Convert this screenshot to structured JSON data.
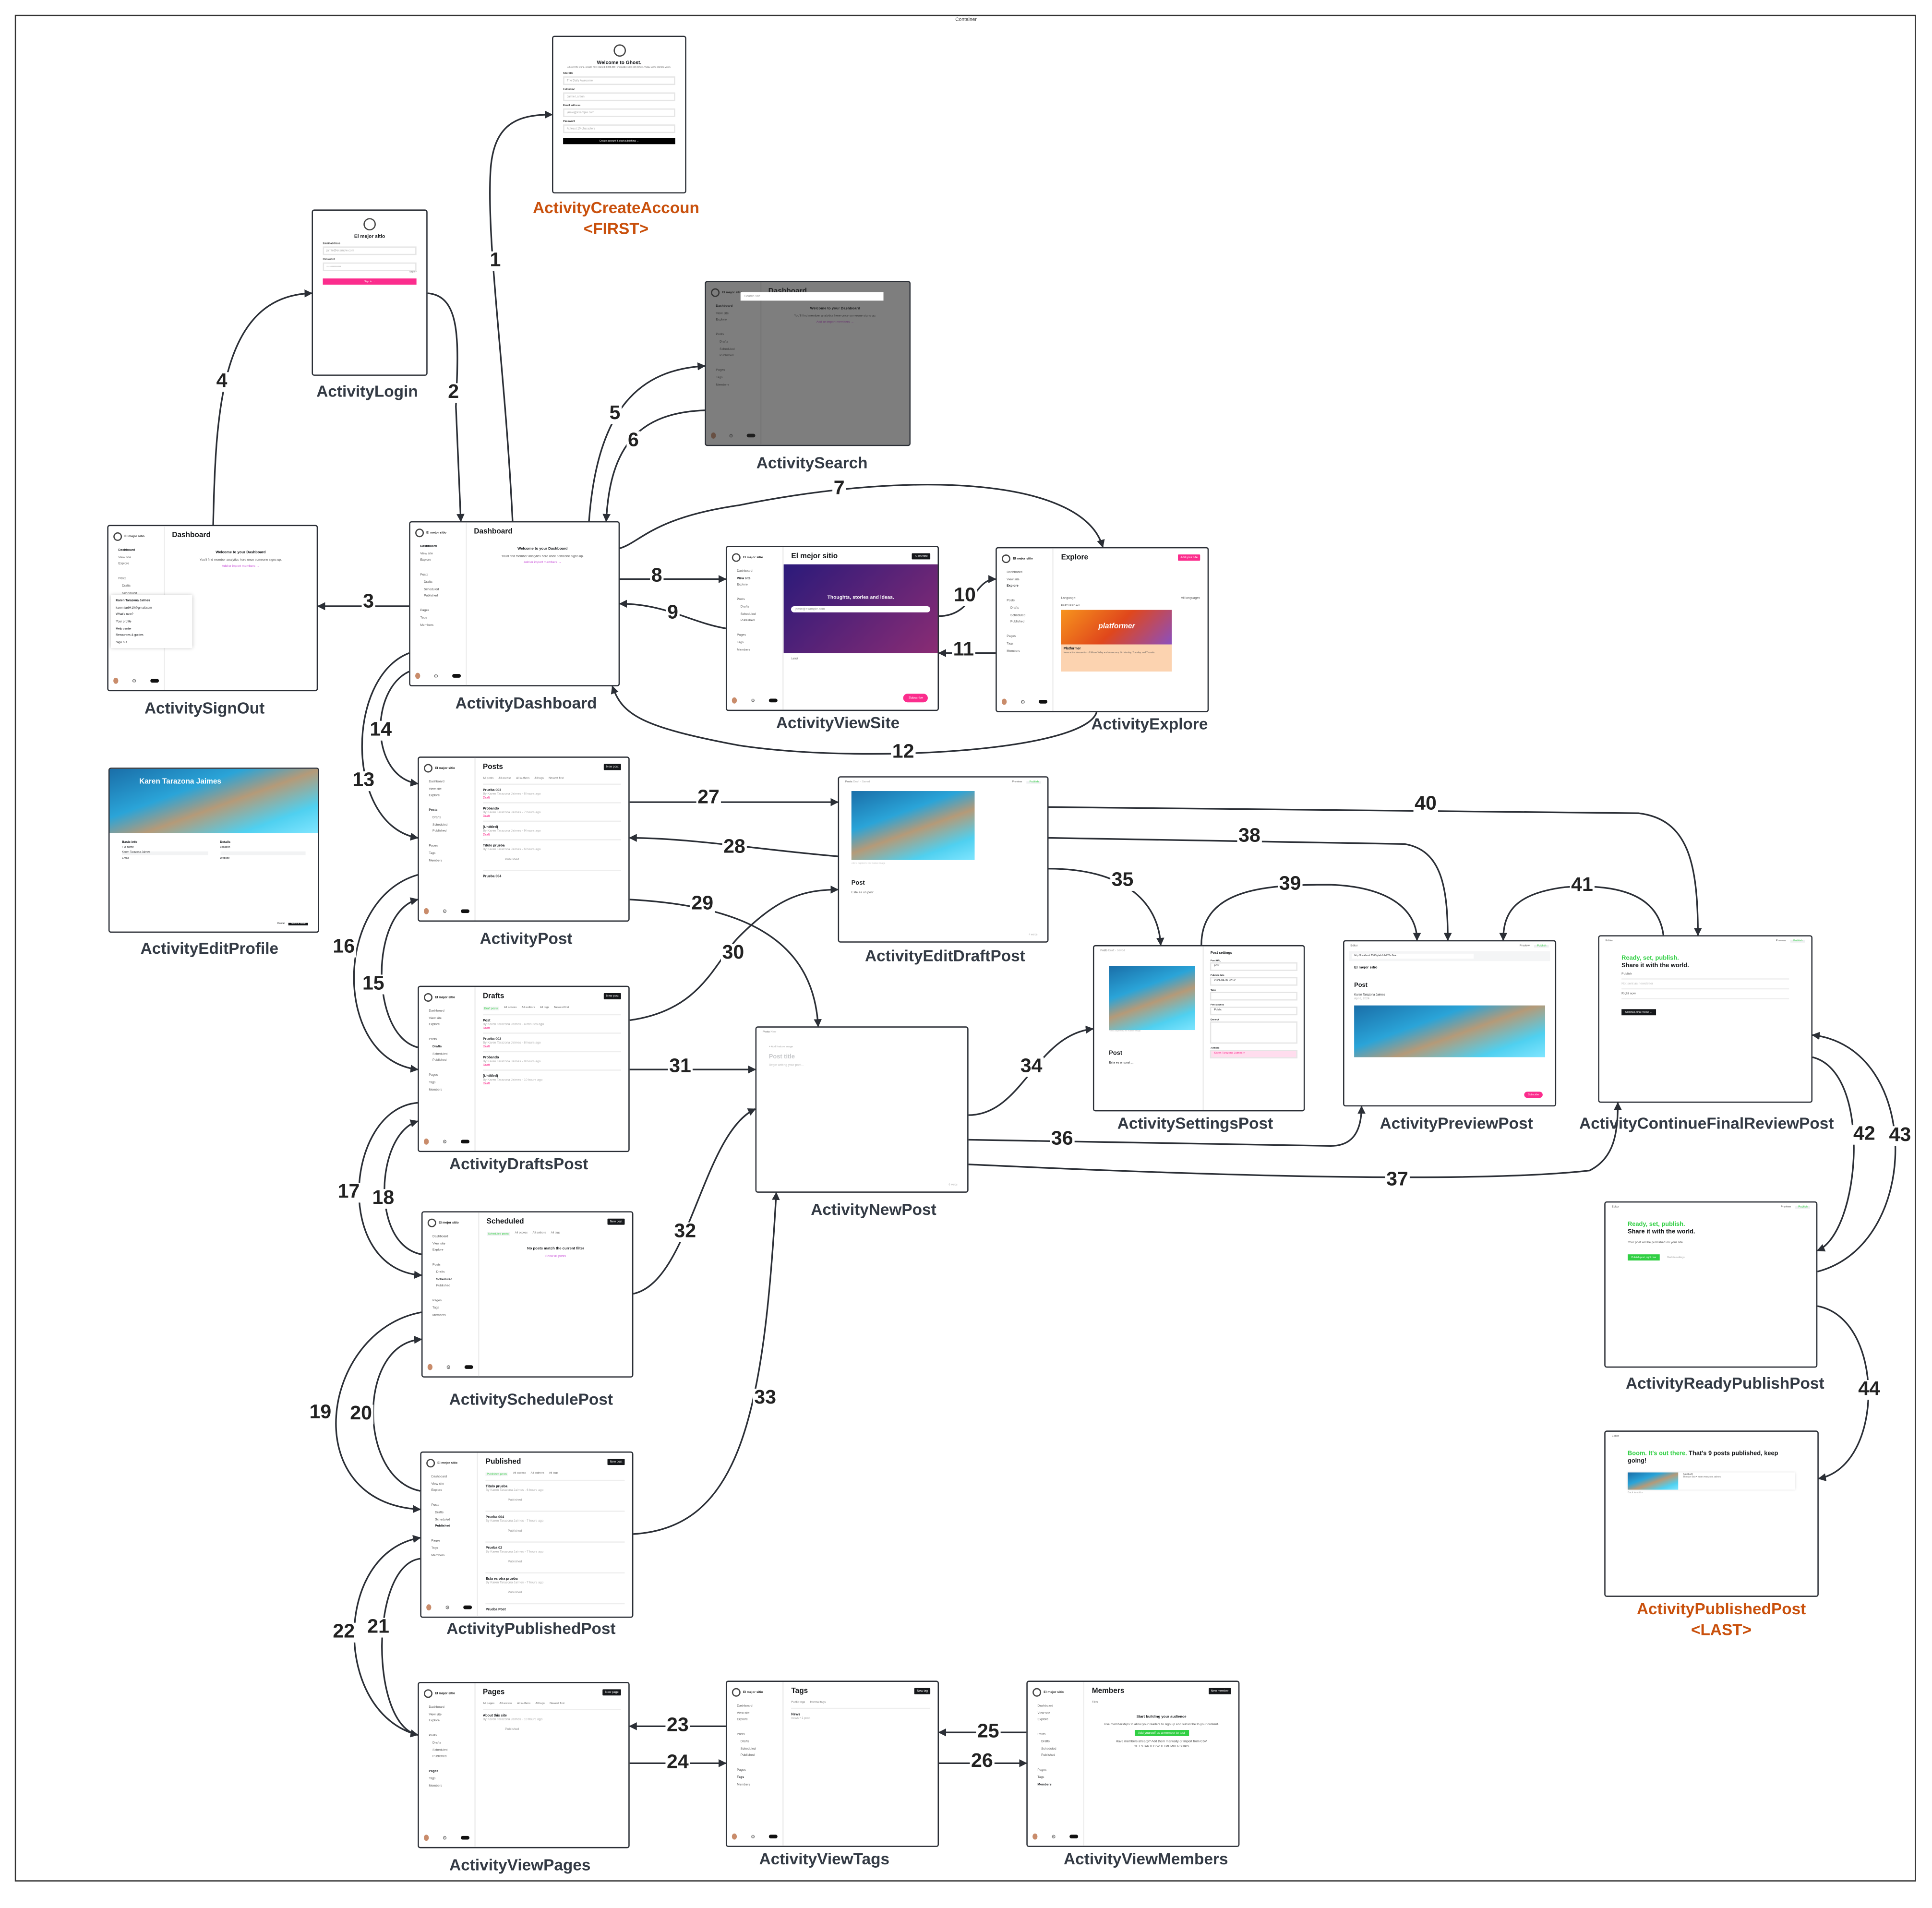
{
  "container_label": "Container",
  "sidebar": {
    "site": "El mejor sitio",
    "items": [
      "Dashboard",
      "View site",
      "Explore",
      "Posts",
      "Drafts",
      "Scheduled",
      "Published",
      "Pages",
      "Tags",
      "Members"
    ],
    "members_count": "0"
  },
  "colors": {
    "accent_green": "#30cf43",
    "accent_pink": "#fb2d8d",
    "label_default": "#333a44",
    "label_terminal": "#c9500c",
    "edge": "#2b2f36"
  },
  "nodes": [
    {
      "id": "create",
      "label": "ActivityCreateAccoun",
      "tag": "<FIRST>",
      "type": "form",
      "screen": {
        "title": "Welcome to Ghost.",
        "subtitle": "All over the world, people have started 3,000,000+ incredible sites with Ghost. Today, we're starting yours.",
        "fields": [
          {
            "label": "Site title",
            "placeholder": "The Daily Awesome"
          },
          {
            "label": "Full name",
            "placeholder": "Jamie Larson"
          },
          {
            "label": "Email address",
            "placeholder": "jamie@example.com"
          },
          {
            "label": "Password",
            "placeholder": "At least 10 characters"
          }
        ],
        "button": "Create account & start publishing →"
      }
    },
    {
      "id": "login",
      "label": "ActivityLogin",
      "type": "form",
      "screen": {
        "title": "El mejor sitio",
        "fields": [
          {
            "label": "Email address",
            "placeholder": "jamie@example.com"
          },
          {
            "label": "Password",
            "placeholder": "••••••••••••••"
          }
        ],
        "link": "Forgot?",
        "button": "Sign in →"
      }
    },
    {
      "id": "search",
      "label": "ActivitySearch",
      "type": "admin",
      "dim": true,
      "screen": {
        "title": "Dashboard",
        "search_placeholder": "Search site",
        "body": [
          "Welcome to your Dashboard",
          "You'll find member analytics here once someone signs up.",
          "Add or import members →"
        ]
      }
    },
    {
      "id": "signout",
      "label": "ActivitySignOut",
      "type": "admin",
      "screen": {
        "title": "Dashboard",
        "menu": [
          "Karen Tarazona Jaimes",
          "karen.far9410@gmail.com",
          "What's new?",
          "Your profile",
          "Help center",
          "Resources & guides",
          "Sign out"
        ],
        "body": [
          "Welcome to your Dashboard",
          "You'll find member analytics here once someone signs up.",
          "Add or import members →"
        ]
      }
    },
    {
      "id": "dashboard",
      "label": "ActivityDashboard",
      "type": "admin",
      "screen": {
        "title": "Dashboard",
        "body": [
          "Welcome to your Dashboard",
          "You'll find member analytics here once someone signs up.",
          "Add or import members →"
        ]
      }
    },
    {
      "id": "viewsite",
      "label": "ActivityViewSite",
      "type": "admin",
      "screen": {
        "title": "El mejor sitio",
        "hero": "Thoughts, stories and ideas.",
        "email_placeholder": "jamie@example.com",
        "latest": "Latest",
        "button": "Subscribe"
      }
    },
    {
      "id": "explore",
      "label": "ActivityExplore",
      "type": "admin",
      "screen": {
        "title": "Explore",
        "button": "Add your site",
        "language_label": "Language:",
        "language_value": "All languages",
        "featured": "FEATURED  ALL",
        "card_logo": "platformer",
        "card_title": "Platformer",
        "card_text": "News at the intersection of Silicon Valley and democracy. On Monday, Tuesday, and Thursda..."
      }
    },
    {
      "id": "editprofile",
      "label": "ActivityEditProfile",
      "type": "profile",
      "screen": {
        "name": "Karen Tarazona Jaimes",
        "basic": "Basic info",
        "details": "Details",
        "full_name_label": "Full name",
        "full_name": "Karen Tarazona Jaimes",
        "location_label": "Location",
        "email_label": "Email",
        "website_label": "Website",
        "cancel": "Cancel",
        "save": "Save & close"
      }
    },
    {
      "id": "post",
      "label": "ActivityPost",
      "type": "admin",
      "screen": {
        "title": "Posts",
        "button": "New post",
        "filters": [
          "All posts",
          "All access",
          "All authors",
          "All tags",
          "Newest first"
        ],
        "items": [
          {
            "title": "Prueba 003",
            "meta": "By Karen Tarazona Jaimes - 6 hours ago",
            "status": "Draft"
          },
          {
            "title": "Probando",
            "meta": "By Karen Tarazona Jaimes - 7 hours ago",
            "status": "Draft"
          },
          {
            "title": "(Untitled)",
            "meta": "By Karen Tarazona Jaimes - 9 hours ago",
            "status": "Draft"
          },
          {
            "title": "Titulo prueba",
            "meta": "By Karen Tarazona Jaimes - 6 hours ago",
            "status": "Published"
          },
          {
            "title": "Prueba 004",
            "meta": "",
            "status": ""
          }
        ]
      }
    },
    {
      "id": "editdraft",
      "label": "ActivityEditDraftPost",
      "type": "editor",
      "screen": {
        "back": "Posts",
        "state": "Draft - Saved",
        "preview": "Preview",
        "publish": "Publish",
        "caption": "Add a caption to the feature image",
        "title": "Post",
        "body": "Este es un post ...",
        "words": "4 words"
      }
    },
    {
      "id": "settings",
      "label": "ActivitySettingsPost",
      "type": "settings",
      "screen": {
        "back": "Posts",
        "state": "Draft - Saved",
        "caption": "Add a caption to the feature image",
        "title": "Post",
        "body": "Este es un post ...",
        "panel_title": "Post settings",
        "fields": [
          {
            "label": "Post URL",
            "value": "post"
          },
          {
            "label": "Publish date",
            "value": "2024-04-06   22:52"
          },
          {
            "label": "Tags",
            "value": ""
          },
          {
            "label": "Post access",
            "value": "Public"
          },
          {
            "label": "Excerpt",
            "value": ""
          },
          {
            "label": "Authors",
            "value": "Karen Tarazona Jaimes ×"
          }
        ]
      }
    },
    {
      "id": "preview",
      "label": "ActivityPreviewPost",
      "type": "preview",
      "screen": {
        "back": "Editor",
        "preview": "Preview",
        "publish": "Publish",
        "url": "http://localhost:2368/p/eb1db778-c9aa...",
        "site": "El mejor sitio",
        "title": "Post",
        "author": "Karen Tarazona Jaimes",
        "date": "Apr 6, 2024",
        "button": "Subscribe"
      }
    },
    {
      "id": "continue",
      "label": "ActivityContinueFinalReviewPost",
      "type": "publish",
      "screen": {
        "back": "Editor",
        "preview": "Preview",
        "publish": "Publish",
        "green": "Ready, set, publish.",
        "black": "Share it with the world.",
        "options": [
          "Publish",
          "Not sent as newsletter",
          "Right now"
        ],
        "button": "Continue, final review →"
      }
    },
    {
      "id": "drafts",
      "label": "ActivityDraftsPost",
      "type": "admin",
      "screen": {
        "title": "Drafts",
        "button": "New post",
        "filters": [
          "Draft posts",
          "All access",
          "All authors",
          "All tags",
          "Newest first"
        ],
        "active_filter": true,
        "items": [
          {
            "title": "Post",
            "meta": "By Karen Tarazona Jaimes - 4 minutes ago",
            "status": "Draft"
          },
          {
            "title": "Prueba 003",
            "meta": "By Karen Tarazona Jaimes - 8 hours ago",
            "status": "Draft"
          },
          {
            "title": "Probando",
            "meta": "By Karen Tarazona Jaimes - 8 hours ago",
            "status": "Draft"
          },
          {
            "title": "(Untitled)",
            "meta": "By Karen Tarazona Jaimes - 10 hours ago",
            "status": "Draft"
          }
        ]
      }
    },
    {
      "id": "newpost",
      "label": "ActivityNewPost",
      "type": "editor",
      "screen": {
        "back": "Posts",
        "state": "New",
        "feature": "+ Add feature image",
        "title": "Post title",
        "body": "Begin writing your post...",
        "words": "0 words",
        "placeholder": true
      }
    },
    {
      "id": "ready",
      "label": "ActivityReadyPublishPost",
      "type": "publish",
      "screen": {
        "back": "Editor",
        "preview": "Preview",
        "publish": "Publish",
        "green": "Ready, set, publish.",
        "black": "Share it with the world.",
        "note": "Your post will be published on your site.",
        "button": "Publish post, right now",
        "secondary": "Back to settings"
      }
    },
    {
      "id": "schedule",
      "label": "ActivitySchedulePost",
      "type": "admin",
      "screen": {
        "title": "Scheduled",
        "button": "New post",
        "filters": [
          "Scheduled posts",
          "All access",
          "All authors",
          "All tags"
        ],
        "active_filter": true,
        "body": [
          "No posts match the current filter",
          "Show all posts"
        ]
      }
    },
    {
      "id": "published",
      "label": "ActivityPublishedPost",
      "type": "admin",
      "screen": {
        "title": "Published",
        "button": "New post",
        "filters": [
          "Published posts",
          "All access",
          "All authors",
          "All tags"
        ],
        "active_filter": true,
        "items": [
          {
            "title": "Titulo prueba",
            "meta": "By Karen Tarazona Jaimes - 6 hours ago",
            "status": "Published"
          },
          {
            "title": "Prueba 004",
            "meta": "By Karen Tarazona Jaimes - 7 hours ago",
            "status": "Published"
          },
          {
            "title": "Prueba 02",
            "meta": "By Karen Tarazona Jaimes - 7 hours ago",
            "status": "Published"
          },
          {
            "title": "Esta es otra prueba",
            "meta": "By Karen Tarazona Jaimes - 7 hours ago",
            "status": "Published"
          },
          {
            "title": "Prueba Post",
            "meta": "",
            "status": ""
          }
        ]
      }
    },
    {
      "id": "publishedpost",
      "label": "ActivityPublishedPost",
      "tag": "<LAST>",
      "type": "publish",
      "screen": {
        "back": "Editor",
        "green": "Boom. It's out there.",
        "black": "That's 9 posts published, keep going!",
        "card_title": "(Untitled)",
        "card_meta": "El mejor sitio • Karen Tarazona Jaimes",
        "secondary": "Back to editor"
      }
    },
    {
      "id": "pages",
      "label": "ActivityViewPages",
      "type": "admin",
      "screen": {
        "title": "Pages",
        "button": "New page",
        "filters": [
          "All pages",
          "All access",
          "All authors",
          "All tags",
          "Newest first"
        ],
        "items": [
          {
            "title": "About this site",
            "meta": "By Karen Tarazona Jaimes - 10 hours ago",
            "status": "Published"
          }
        ]
      }
    },
    {
      "id": "tags",
      "label": "ActivityViewTags",
      "type": "admin",
      "screen": {
        "title": "Tags",
        "button": "New tag",
        "filters": [
          "Public tags",
          "Internal tags"
        ],
        "items": [
          {
            "title": "News",
            "meta": "news • 1 post",
            "status": ""
          }
        ]
      }
    },
    {
      "id": "members",
      "label": "ActivityViewMembers",
      "type": "admin",
      "screen": {
        "title": "Members",
        "button": "New member",
        "filters": [
          "Filter"
        ],
        "body": [
          "Start building your audience",
          "Use memberships to allow your readers to sign up and subscribe to your content.",
          "Add yourself as a member to test",
          "Have members already? Add them manually or import from CSV",
          "GET STARTED WITH MEMBERSHIPS"
        ]
      }
    }
  ],
  "edges": [
    {
      "label": "1",
      "from": "dashboard",
      "to": "create"
    },
    {
      "label": "2",
      "from": "login",
      "to": "dashboard"
    },
    {
      "label": "3",
      "from": "dashboard",
      "to": "signout"
    },
    {
      "label": "4",
      "from": "signout",
      "to": "login"
    },
    {
      "label": "5",
      "from": "dashboard",
      "to": "search"
    },
    {
      "label": "6",
      "from": "search",
      "to": "dashboard"
    },
    {
      "label": "7",
      "from": "dashboard",
      "to": "explore"
    },
    {
      "label": "8",
      "from": "dashboard",
      "to": "viewsite"
    },
    {
      "label": "9",
      "from": "viewsite",
      "to": "dashboard"
    },
    {
      "label": "10",
      "from": "viewsite",
      "to": "explore"
    },
    {
      "label": "11",
      "from": "explore",
      "to": "viewsite"
    },
    {
      "label": "12",
      "from": "explore",
      "to": "dashboard"
    },
    {
      "label": "13",
      "from": "dashboard",
      "to": "post"
    },
    {
      "label": "14",
      "from": "post",
      "to": "dashboard"
    },
    {
      "label": "15",
      "from": "drafts",
      "to": "post"
    },
    {
      "label": "16",
      "from": "post",
      "to": "drafts"
    },
    {
      "label": "17",
      "from": "drafts",
      "to": "schedule"
    },
    {
      "label": "18",
      "from": "schedule",
      "to": "drafts"
    },
    {
      "label": "19",
      "from": "schedule",
      "to": "published"
    },
    {
      "label": "20",
      "from": "published",
      "to": "schedule"
    },
    {
      "label": "21",
      "from": "published",
      "to": "pages"
    },
    {
      "label": "22",
      "from": "pages",
      "to": "published"
    },
    {
      "label": "23",
      "from": "tags",
      "to": "pages"
    },
    {
      "label": "24",
      "from": "pages",
      "to": "tags"
    },
    {
      "label": "25",
      "from": "members",
      "to": "tags"
    },
    {
      "label": "26",
      "from": "tags",
      "to": "members"
    },
    {
      "label": "27",
      "from": "post",
      "to": "editdraft"
    },
    {
      "label": "28",
      "from": "editdraft",
      "to": "post"
    },
    {
      "label": "29",
      "from": "post",
      "to": "newpost"
    },
    {
      "label": "30",
      "from": "drafts",
      "to": "editdraft"
    },
    {
      "label": "31",
      "from": "drafts",
      "to": "newpost"
    },
    {
      "label": "32",
      "from": "schedule",
      "to": "newpost"
    },
    {
      "label": "33",
      "from": "published",
      "to": "newpost"
    },
    {
      "label": "34",
      "from": "newpost",
      "to": "settings"
    },
    {
      "label": "35",
      "from": "editdraft",
      "to": "settings"
    },
    {
      "label": "36",
      "from": "newpost",
      "to": "preview"
    },
    {
      "label": "37",
      "from": "newpost",
      "to": "continue"
    },
    {
      "label": "38",
      "from": "editdraft",
      "to": "preview"
    },
    {
      "label": "39",
      "from": "settings",
      "to": "preview"
    },
    {
      "label": "40",
      "from": "editdraft",
      "to": "continue"
    },
    {
      "label": "41",
      "from": "continue",
      "to": "preview"
    },
    {
      "label": "42",
      "from": "continue",
      "to": "ready"
    },
    {
      "label": "43",
      "from": "ready",
      "to": "continue"
    },
    {
      "label": "44",
      "from": "ready",
      "to": "publishedpost"
    }
  ]
}
